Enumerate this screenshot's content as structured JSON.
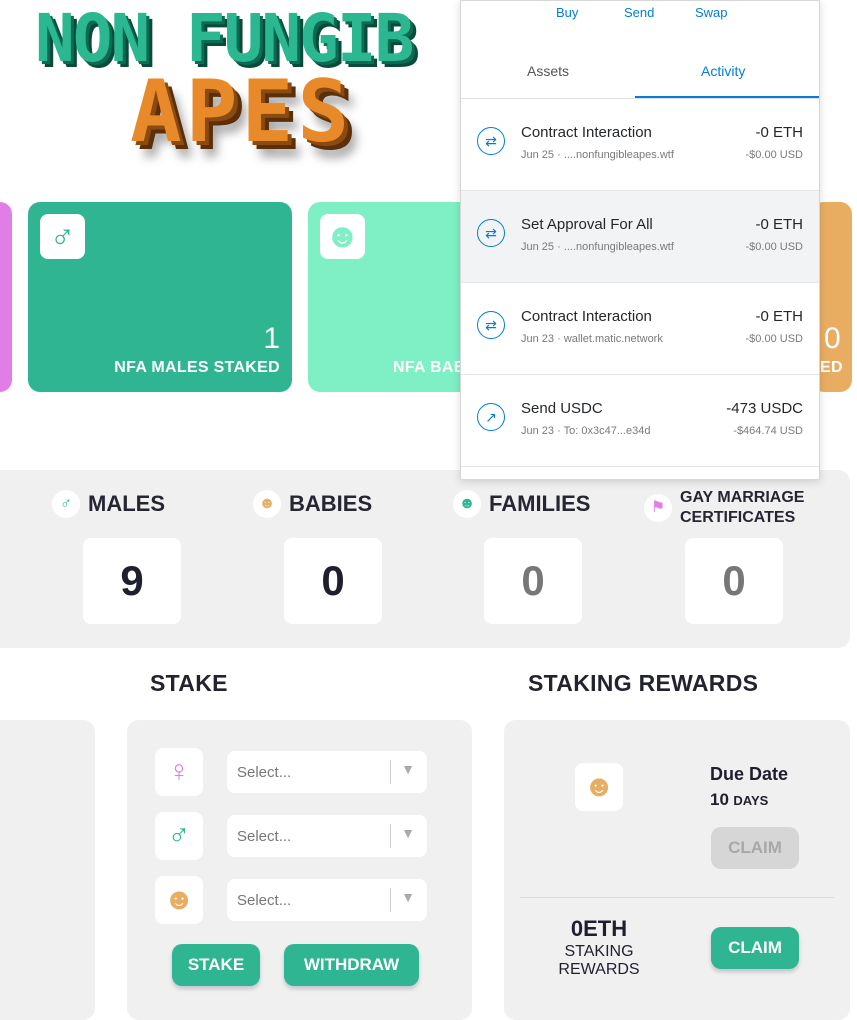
{
  "logo": {
    "line1": "NON FUNGIB",
    "line2": "APES"
  },
  "cards": {
    "male": {
      "count": "1",
      "label": "NFA MALES STAKED"
    },
    "baby": {
      "label": "NFA BAB"
    },
    "orange": {
      "count": "0",
      "label": "ED"
    }
  },
  "counts": [
    {
      "label": "MALES",
      "value": "9"
    },
    {
      "label": "BABIES",
      "value": "0"
    },
    {
      "label": "FAMILIES",
      "value": "0"
    },
    {
      "label_l1": "GAY MARRIAGE",
      "label_l2": "CERTIFICATES",
      "value": "0"
    }
  ],
  "stake": {
    "title": "STAKE",
    "select_placeholder": "Select...",
    "stake_btn": "STAKE",
    "withdraw_btn": "WITHDRAW"
  },
  "rewards": {
    "title": "STAKING REWARDS",
    "due_label": "Due Date",
    "due_value": "10",
    "due_unit": "DAYS",
    "claim_disabled": "CLAIM",
    "eth_amount": "0ETH",
    "eth_label_l1": "STAKING",
    "eth_label_l2": "REWARDS",
    "claim": "CLAIM"
  },
  "wallet": {
    "actions": [
      "Buy",
      "Send",
      "Swap"
    ],
    "tabs": [
      "Assets",
      "Activity"
    ],
    "transactions": [
      {
        "title": "Contract Interaction",
        "date": "Jun 25",
        "origin": "....nonfungibleapes.wtf",
        "amount": "-0 ETH",
        "usd": "-$0.00 USD"
      },
      {
        "title": "Set Approval For All",
        "date": "Jun 25",
        "origin": "....nonfungibleapes.wtf",
        "amount": "-0 ETH",
        "usd": "-$0.00 USD"
      },
      {
        "title": "Contract Interaction",
        "date": "Jun 23",
        "origin": "wallet.matic.network",
        "amount": "-0 ETH",
        "usd": "-$0.00 USD"
      },
      {
        "title": "Send USDC",
        "date": "Jun 23",
        "origin": "To: 0x3c47...e34d",
        "amount": "-473 USDC",
        "usd": "-$464.74 USD"
      }
    ]
  },
  "colors": {
    "green": "#2fb592",
    "mint": "#7ff0c6",
    "pink": "#e07ee6",
    "orange": "#e9ad62",
    "blue": "#037dd6"
  }
}
